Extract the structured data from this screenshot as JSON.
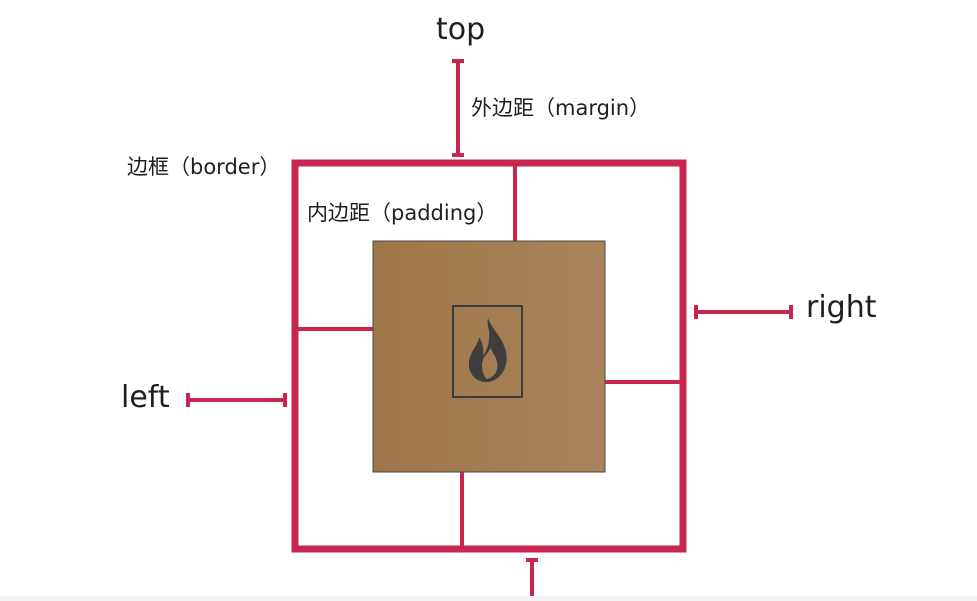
{
  "labels": {
    "top": "top",
    "right": "right",
    "left": "left",
    "margin": "外边距（margin）",
    "border": "边框（border）",
    "padding": "内边距（padding）"
  },
  "colors": {
    "border_line": "#c8254f",
    "content_left": "#a27a50",
    "content_right": "#a88259",
    "icon_frame": "#4a4a4a",
    "flame": "#3e3e3e",
    "text": "#1f1f1f"
  },
  "icons": {
    "content_icon": "flame-icon"
  }
}
